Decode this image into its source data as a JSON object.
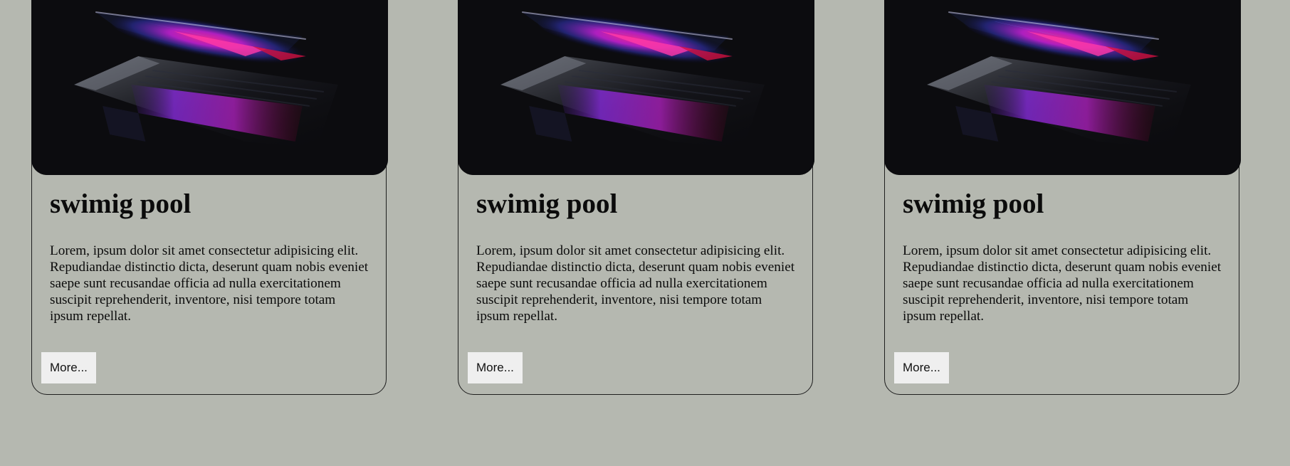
{
  "cards": [
    {
      "image": "laptop-keyboard-neon-photo",
      "title": "swimig pool",
      "text": "Lorem, ipsum dolor sit amet consectetur adipisicing elit. Repudiandae distinctio dicta, deserunt quam nobis eveniet saepe sunt recusandae officia ad nulla exercitationem suscipit reprehenderit, inventore, nisi tempore totam ipsum repellat.",
      "button_label": "More..."
    },
    {
      "image": "laptop-keyboard-neon-photo",
      "title": "swimig pool",
      "text": "Lorem, ipsum dolor sit amet consectetur adipisicing elit. Repudiandae distinctio dicta, deserunt quam nobis eveniet saepe sunt recusandae officia ad nulla exercitationem suscipit reprehenderit, inventore, nisi tempore totam ipsum repellat.",
      "button_label": "More..."
    },
    {
      "image": "laptop-keyboard-neon-photo",
      "title": "swimig pool",
      "text": "Lorem, ipsum dolor sit amet consectetur adipisicing elit. Repudiandae distinctio dicta, deserunt quam nobis eveniet saepe sunt recusandae officia ad nulla exercitationem suscipit reprehenderit, inventore, nisi tempore totam ipsum repellat.",
      "button_label": "More..."
    }
  ],
  "colors": {
    "page_background": "#b5b8b0",
    "card_border": "#1e1e1e",
    "button_background": "#efefef",
    "image_background": "#0c0c0f"
  }
}
